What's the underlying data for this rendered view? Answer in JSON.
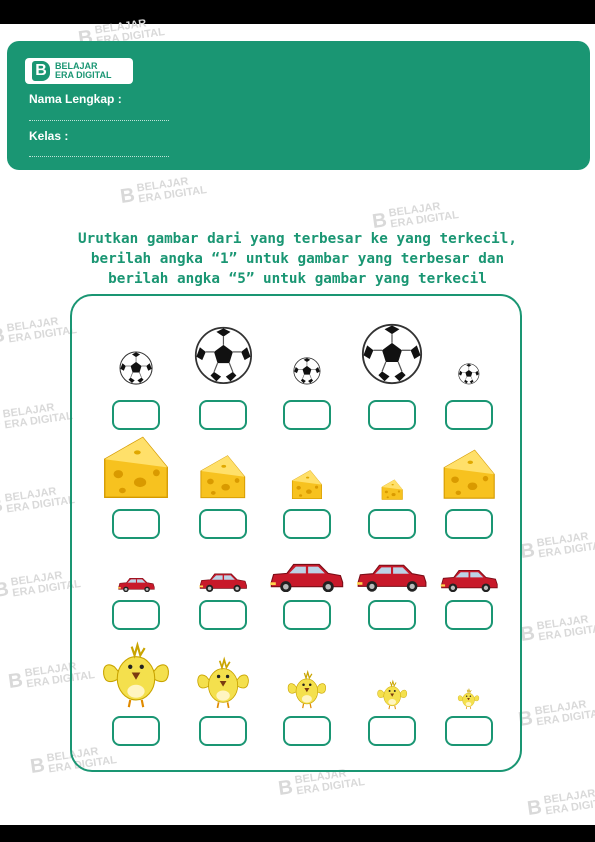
{
  "brand": {
    "line1": "BELAJAR",
    "line2": "ERA DIGITAL",
    "mark": "B"
  },
  "form": {
    "name_label": "Nama Lengkap :",
    "class_label": "Kelas :"
  },
  "instructions": [
    "Urutkan gambar dari yang terbesar ke yang terkecil,",
    "berilah angka “1” untuk gambar yang terbesar dan",
    "berilah angka “5” untuk gambar yang terkecil"
  ],
  "colors": {
    "accent": "#1a9673",
    "ball": "#111111",
    "cheese": "#f7c21f",
    "car": "#c8192a",
    "chick": "#f4e04d"
  },
  "rows": [
    {
      "object": "soccer-ball",
      "icon": "soccer-ball-icon",
      "sizes": [
        0.55,
        0.95,
        0.45,
        1.0,
        0.35
      ]
    },
    {
      "object": "cheese",
      "icon": "cheese-icon",
      "sizes": [
        1.0,
        0.7,
        0.47,
        0.33,
        0.8
      ]
    },
    {
      "object": "car",
      "icon": "car-icon",
      "sizes": [
        0.5,
        0.65,
        1.0,
        0.95,
        0.78
      ]
    },
    {
      "object": "chick",
      "icon": "chick-icon",
      "sizes": [
        1.0,
        0.78,
        0.58,
        0.45,
        0.32
      ]
    }
  ]
}
